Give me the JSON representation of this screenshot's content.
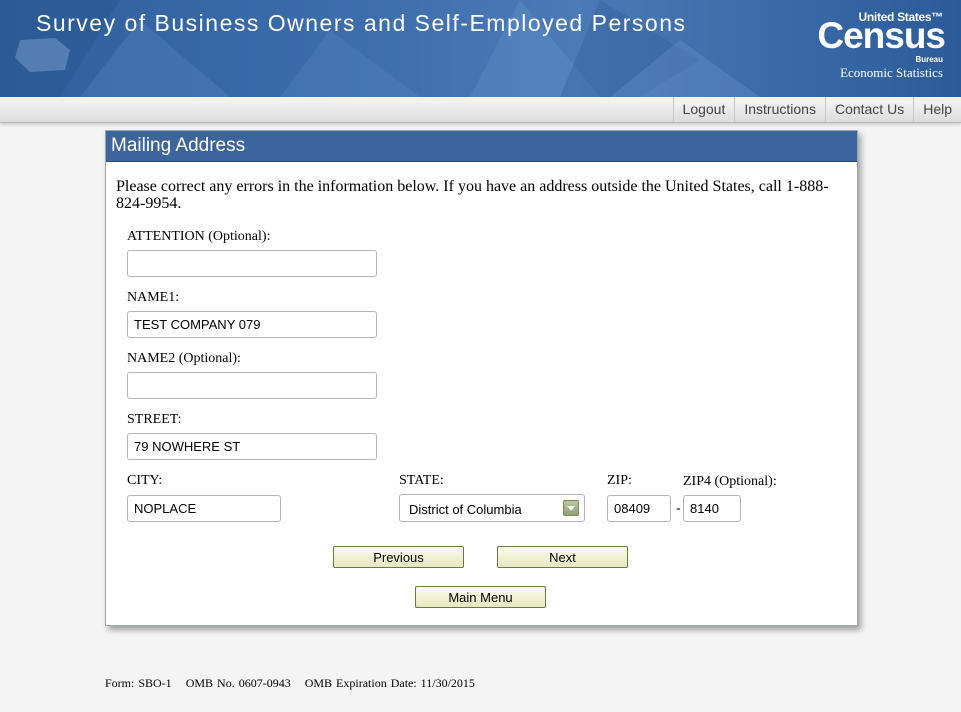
{
  "header": {
    "title": "Survey of Business Owners and Self-Employed Persons",
    "logo": {
      "united_states": "United States™",
      "census": "Census",
      "bureau": "Bureau",
      "division": "Economic Statistics"
    }
  },
  "nav": {
    "logout": "Logout",
    "instructions": "Instructions",
    "contact": "Contact Us",
    "help": "Help"
  },
  "panel": {
    "title": "Mailing Address",
    "instructions": "Please correct any errors in the information below. If you have an address outside the United States, call 1-888-824-9954."
  },
  "form": {
    "attention": {
      "label": "ATTENTION (Optional):",
      "value": ""
    },
    "name1": {
      "label": "NAME1:",
      "value": "TEST COMPANY 079"
    },
    "name2": {
      "label": "NAME2 (Optional):",
      "value": ""
    },
    "street": {
      "label": "STREET:",
      "value": "79 NOWHERE ST"
    },
    "city": {
      "label": "CITY:",
      "value": "NOPLACE"
    },
    "state": {
      "label": "STATE:",
      "value": "District of Columbia"
    },
    "zip": {
      "label": "ZIP:",
      "value": "08409"
    },
    "zip4": {
      "label": "ZIP4 (Optional):",
      "value": "8140"
    },
    "zip_separator": "-"
  },
  "buttons": {
    "previous": "Previous",
    "next": "Next",
    "main_menu": "Main Menu"
  },
  "footer": {
    "form": "Form: SBO-1",
    "omb_no": "OMB No. 0607-0943",
    "omb_exp": "OMB Expiration Date: 11/30/2015"
  },
  "colors": {
    "banner": "#3b6cab",
    "panel_header": "#3c659e",
    "button_border": "#6d7a3f"
  }
}
